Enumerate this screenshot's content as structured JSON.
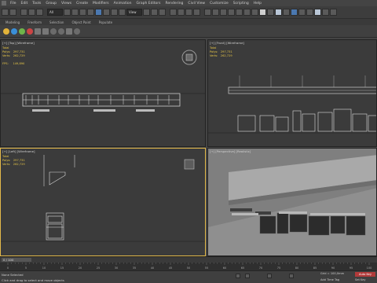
{
  "menubar": {
    "items": [
      "File",
      "Edit",
      "Tools",
      "Group",
      "Views",
      "Create",
      "Modifiers",
      "Animation",
      "Graph Editors",
      "Rendering",
      "Civil View",
      "Customize",
      "Scripting",
      "Help"
    ]
  },
  "toolbar": {
    "selection_filter": "All",
    "view_dropdown": "View"
  },
  "ribbon": {
    "tabs": [
      "Modeling",
      "Freeform",
      "Selection",
      "Object Paint",
      "Populate"
    ]
  },
  "viewports": {
    "top": {
      "label": "[+] [Top] [Wireframe]",
      "stats": "Total\nPolys:   297,731\nVerts:   262,729\n\nFPS:     149,890"
    },
    "front": {
      "label": "[+] [Front] [Wireframe]",
      "stats": "Total\nPolys:   297,731\nVerts:   262,729"
    },
    "left": {
      "label": "[+] [Left] [Wireframe]",
      "stats": "Total\nPolys:   297,731\nVerts:   262,729"
    },
    "persp": {
      "label": "[+] [Perspective] [Realistic]"
    }
  },
  "timeline": {
    "frame_counter": "0 / 100",
    "ticks": [
      "0",
      "5",
      "10",
      "15",
      "20",
      "25",
      "30",
      "35",
      "40",
      "45",
      "50",
      "55",
      "60",
      "65",
      "70",
      "75",
      "80",
      "85",
      "90",
      "95",
      "100"
    ]
  },
  "status": {
    "line1": "None Selected",
    "line2": "Click and drag to select and move objects",
    "grid": "Grid = 100,0mm",
    "add_time_tag": "Add Time Tag",
    "auto_key": "Auto Key",
    "set_key": "Set Key"
  },
  "colors": {
    "active_border": "#e3b94a",
    "stats": "#e6c547",
    "auto_key": "#b13a3a"
  }
}
